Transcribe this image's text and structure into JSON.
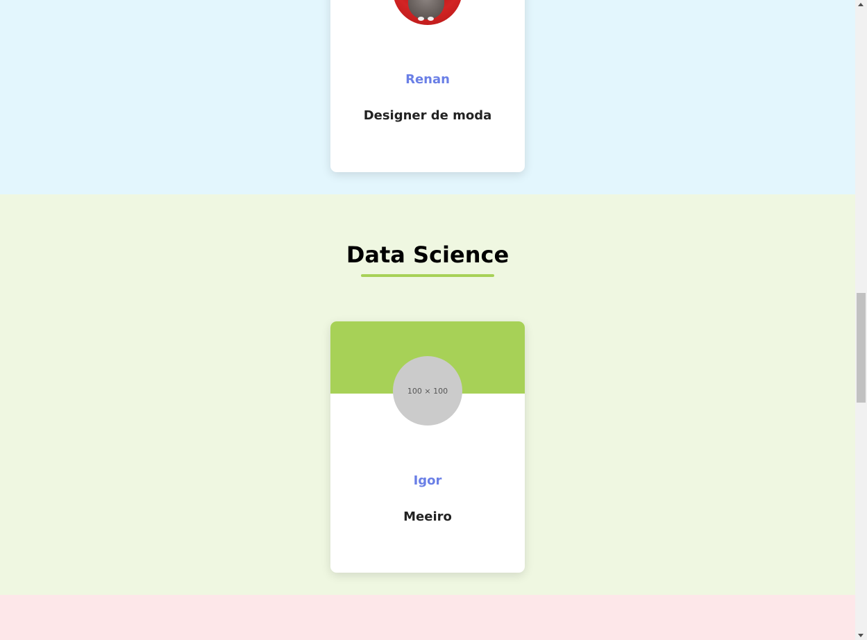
{
  "colors": {
    "section_top_bg": "#e3f6fd",
    "section_mid_bg": "#eff7e1",
    "section_bottom_bg": "#fde7e9",
    "accent_green": "#a7d157",
    "name_color": "#6a7fe6",
    "card_bg": "#ffffff"
  },
  "sections": [
    {
      "card": {
        "name": "Renan",
        "role": "Designer de moda",
        "avatar_icon": "cat-photo"
      }
    },
    {
      "title": "Data Science",
      "card": {
        "name": "Igor",
        "role": "Meeiro",
        "avatar_placeholder": "100 × 100"
      }
    }
  ]
}
